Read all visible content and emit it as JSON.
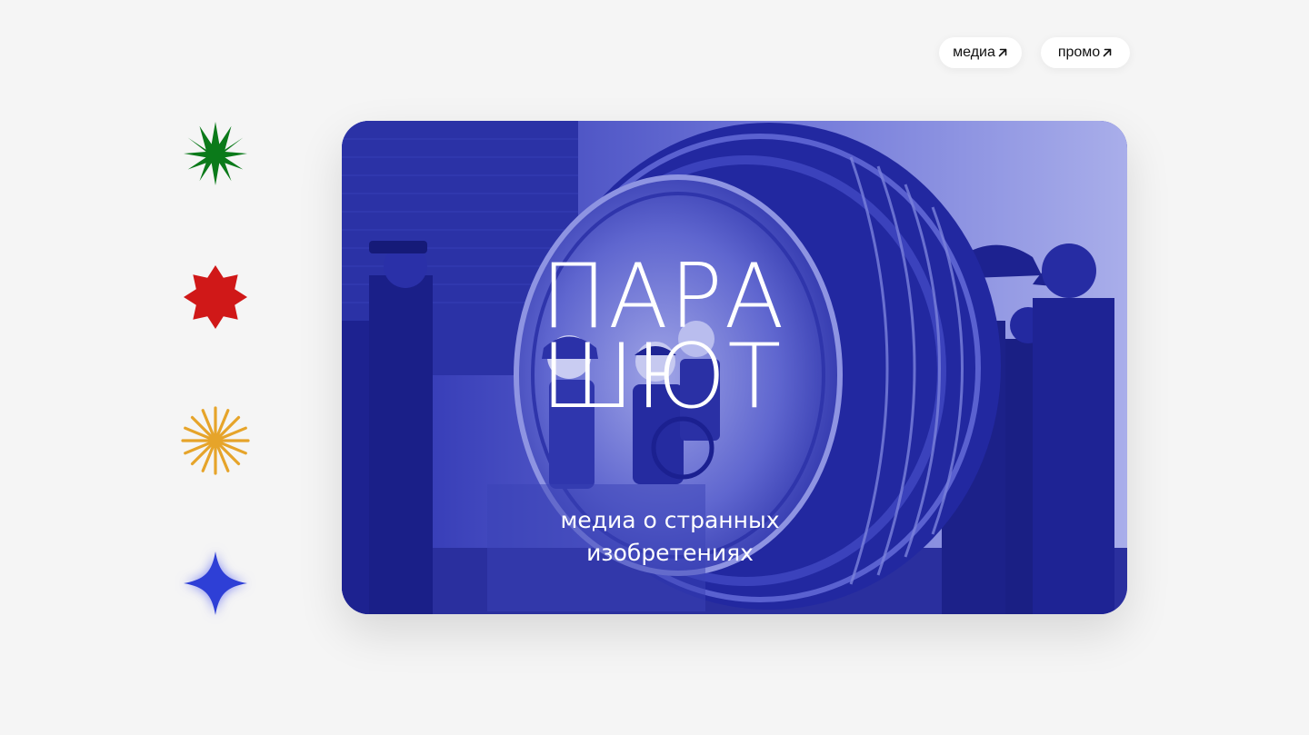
{
  "nav": {
    "items": [
      {
        "label": "медиа",
        "icon": "arrow-up-right-icon"
      },
      {
        "label": "промо",
        "icon": "arrow-up-right-icon"
      }
    ]
  },
  "sidebar": {
    "icons": [
      {
        "name": "green-eight-point-star-icon",
        "color": "#0b7a1a"
      },
      {
        "name": "red-burst-icon",
        "color": "#d01818"
      },
      {
        "name": "yellow-sunburst-icon",
        "color": "#e6a42a"
      },
      {
        "name": "blue-four-point-star-icon",
        "color": "#2e3fd6"
      }
    ]
  },
  "hero": {
    "title_line1": "ПАРА",
    "title_line2": "ШЮТ",
    "subtitle_line1": "медиа о странных",
    "subtitle_line2": "изобретениях",
    "image": "duotone-blue-historic-photo-monowheel-vehicle"
  },
  "colors": {
    "background": "#f5f5f5",
    "hero_dark_blue": "#1f2497",
    "hero_light_blue": "#9aa0e8",
    "pill_background": "#ffffff"
  }
}
